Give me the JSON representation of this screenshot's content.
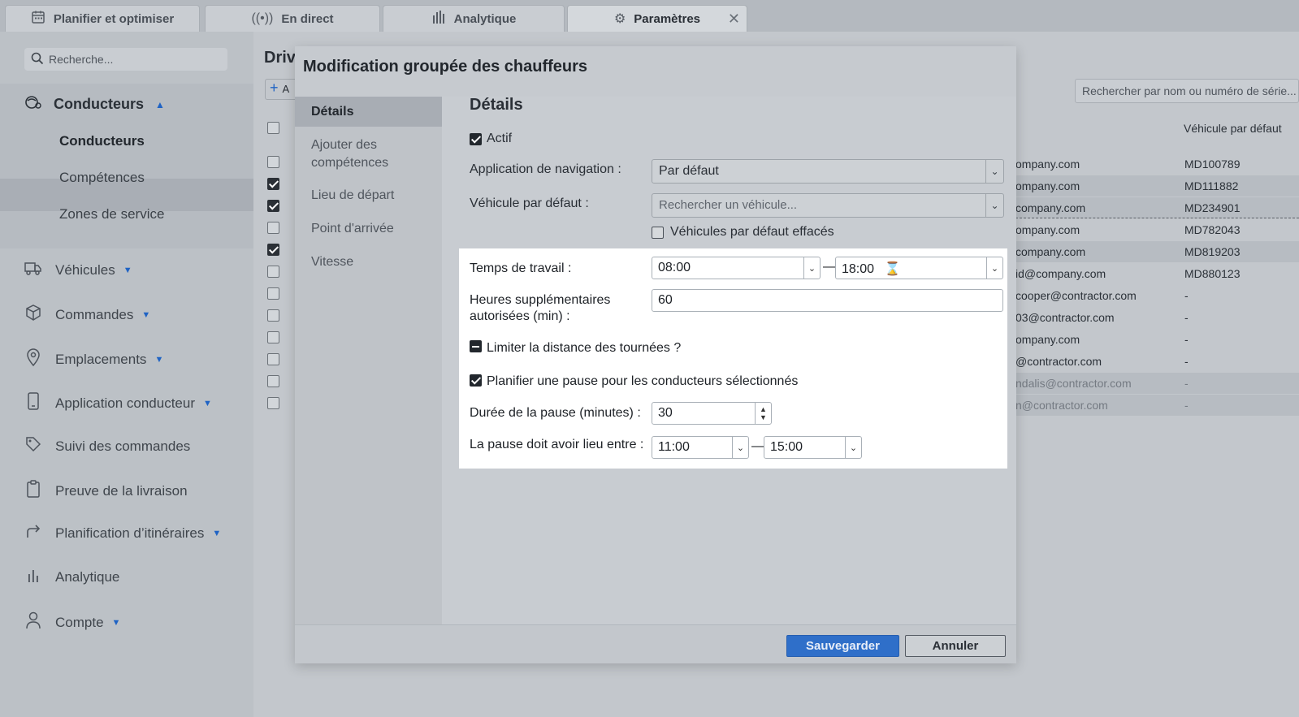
{
  "tabs": [
    {
      "label": "Planifier et optimiser",
      "icon": "calendar-icon"
    },
    {
      "label": "En direct",
      "icon": "broadcast-icon"
    },
    {
      "label": "Analytique",
      "icon": "bar-chart-icon"
    },
    {
      "label": "Paramètres",
      "icon": "gear-icon",
      "active": true
    }
  ],
  "sidebar": {
    "search_placeholder": "Recherche...",
    "section": "Conducteurs",
    "subitems": [
      "Conducteurs",
      "Compétences",
      "Zones de service"
    ],
    "items": [
      {
        "label": "Véhicules",
        "icon": "truck-icon",
        "expandable": true
      },
      {
        "label": "Commandes",
        "icon": "box-icon",
        "expandable": true
      },
      {
        "label": "Emplacements",
        "icon": "location-pin-icon",
        "expandable": true
      },
      {
        "label": "Application conducteur",
        "icon": "phone-icon",
        "expandable": true
      },
      {
        "label": "Suivi des commandes",
        "icon": "tag-icon",
        "expandable": false
      },
      {
        "label": "Preuve de la livraison",
        "icon": "clipboard-icon",
        "expandable": false
      },
      {
        "label": "Planification d’itinéraires",
        "icon": "route-arrow-icon",
        "expandable": true
      },
      {
        "label": "Analytique",
        "icon": "bar-chart-icon",
        "expandable": false
      },
      {
        "label": "Compte",
        "icon": "user-icon",
        "expandable": true
      }
    ]
  },
  "background": {
    "title": "Driv",
    "add_label": "A",
    "search_placeholder": "Rechercher par nom ou numéro de série...",
    "column_default_vehicle": "Véhicule par défaut",
    "rows": [
      {
        "email": "ompany.com",
        "vehicle": "MD100789",
        "checked": false
      },
      {
        "email": "ompany.com",
        "vehicle": "MD111882",
        "checked": true
      },
      {
        "email": "company.com",
        "vehicle": "MD234901",
        "checked": true
      },
      {
        "email": "ompany.com",
        "vehicle": "MD782043",
        "checked": false
      },
      {
        "email": "company.com",
        "vehicle": "MD819203",
        "checked": true
      },
      {
        "email": "id@company.com",
        "vehicle": "MD880123",
        "checked": false
      },
      {
        "email": "cooper@contractor.com",
        "vehicle": "-",
        "checked": false
      },
      {
        "email": "03@contractor.com",
        "vehicle": "-",
        "checked": false
      },
      {
        "email": "ompany.com",
        "vehicle": "-",
        "checked": false
      },
      {
        "email": "@contractor.com",
        "vehicle": "-",
        "checked": false
      },
      {
        "email": "ndalis@contractor.com",
        "vehicle": "-",
        "checked": false
      },
      {
        "email": "n@contractor.com",
        "vehicle": "-",
        "checked": false
      }
    ]
  },
  "modal": {
    "title": "Modification groupée des chauffeurs",
    "nav": [
      "Détails",
      "Ajouter des compétences",
      "Lieu de départ",
      "Point d'arrivée",
      "Vitesse"
    ],
    "section_title": "Détails",
    "active_label": "Actif",
    "nav_app_label": "Application de navigation :",
    "nav_app_value": "Par défaut",
    "default_vehicle_label": "Véhicule par défaut :",
    "default_vehicle_placeholder": "Rechercher un véhicule...",
    "clear_vehicles_label": "Véhicules par défaut effacés",
    "work_time_label": "Temps de travail :",
    "work_start": "08:00",
    "work_end": "18:00",
    "overtime_label": "Heures supplémentaires autorisées (min) :",
    "overtime_value": "60",
    "limit_distance_label": "Limiter la distance des tournées ?",
    "plan_break_label": "Planifier une pause pour les conducteurs sélectionnés",
    "break_duration_label": "Durée de la pause (minutes) :",
    "break_duration_value": "30",
    "break_window_label": "La pause doit avoir lieu entre :",
    "break_start": "11:00",
    "break_end": "15:00",
    "save": "Sauvegarder",
    "cancel": "Annuler"
  }
}
